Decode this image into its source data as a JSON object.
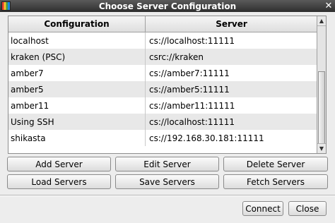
{
  "window": {
    "title": "Choose Server Configuration",
    "close_glyph": "✕",
    "app_icon": "multicolor-app-icon"
  },
  "table": {
    "columns": [
      "Configuration",
      "Server"
    ],
    "rows": [
      {
        "configuration": "localhost",
        "server": "cs://localhost:11111"
      },
      {
        "configuration": "kraken (PSC)",
        "server": "csrc://kraken"
      },
      {
        "configuration": "amber7",
        "server": "cs://amber7:11111"
      },
      {
        "configuration": "amber5",
        "server": "cs://amber5:11111"
      },
      {
        "configuration": "amber11",
        "server": "cs://amber11:11111"
      },
      {
        "configuration": "Using SSH",
        "server": "cs://localhost:11111"
      },
      {
        "configuration": "shikasta",
        "server": "cs://192.168.30.181:11111"
      }
    ]
  },
  "buttons": {
    "add": "Add Server",
    "edit": "Edit Server",
    "delete": "Delete Server",
    "load": "Load Servers",
    "save": "Save Servers",
    "fetch": "Fetch Servers",
    "connect": "Connect",
    "close": "Close"
  }
}
